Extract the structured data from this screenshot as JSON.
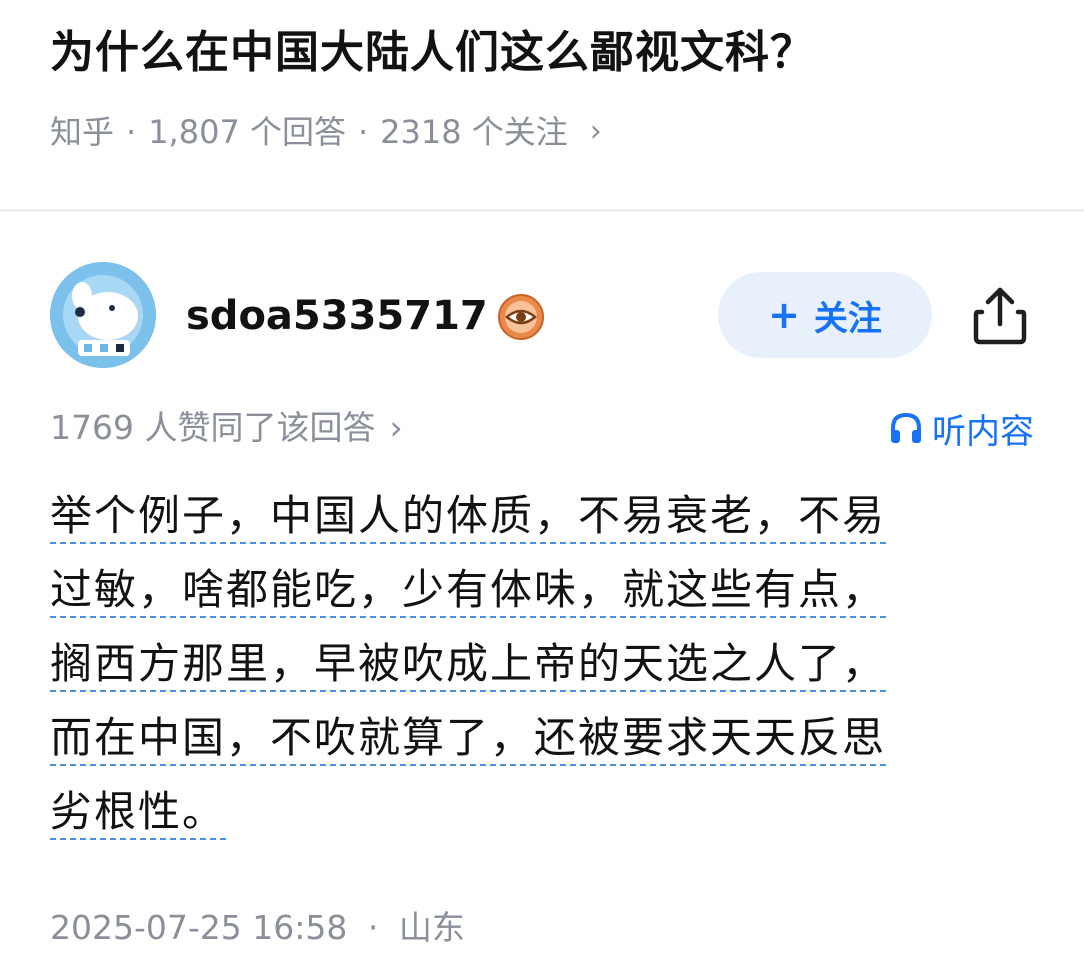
{
  "question": {
    "title": "为什么在中国大陆人们这么鄙视文科？",
    "source": "知乎",
    "answer_count": "1,807 个回答",
    "follower_count": "2318 个关注",
    "separator": "·",
    "chevron": "›"
  },
  "author": {
    "name": "sdoa5335717",
    "avatar_icon": "dog-avatar-icon",
    "badge_icon": "eye-badge-icon",
    "follow_plus": "+",
    "follow_label": "关注",
    "share_icon": "share-icon"
  },
  "answer": {
    "vote_text": "1769 人赞同了该回答",
    "vote_chevron": "›",
    "listen_label": "听内容",
    "listen_icon": "headphones-icon",
    "lines": [
      "举个例子，中国人的体质，不易衰老，不易",
      "过敏，啥都能吃，少有体味，就这些有点，",
      "搁西方那里，早被吹成上帝的天选之人了，",
      "而在中国，不吹就算了，还被要求天天反思",
      "劣根性。"
    ],
    "timestamp": "2025-07-25 16:58",
    "separator": "·",
    "location": "山东"
  },
  "colors": {
    "accent": "#1772f6",
    "follow_bg": "#e8f0fb",
    "meta_text": "#8a8f99",
    "badge": "#e07b39"
  }
}
